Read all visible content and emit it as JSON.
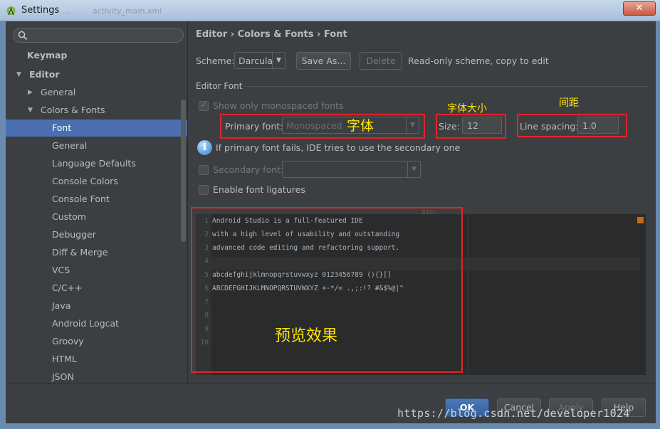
{
  "window": {
    "title": "Settings",
    "ghost_tab_1": "...",
    "ghost_tab_2": "activity_main.xml"
  },
  "sidebar": {
    "search_placeholder": "",
    "items": [
      {
        "label": "Keymap"
      },
      {
        "label": "Editor"
      },
      {
        "label": "General"
      },
      {
        "label": "Colors & Fonts"
      },
      {
        "label": "Font"
      },
      {
        "label": "General"
      },
      {
        "label": "Language Defaults"
      },
      {
        "label": "Console Colors"
      },
      {
        "label": "Console Font"
      },
      {
        "label": "Custom"
      },
      {
        "label": "Debugger"
      },
      {
        "label": "Diff & Merge"
      },
      {
        "label": "VCS"
      },
      {
        "label": "C/C++"
      },
      {
        "label": "Java"
      },
      {
        "label": "Android Logcat"
      },
      {
        "label": "Groovy"
      },
      {
        "label": "HTML"
      },
      {
        "label": "JSON"
      }
    ]
  },
  "breadcrumb": {
    "part1": "Editor",
    "part2": "Colors & Fonts",
    "part3": "Font",
    "sep": "›"
  },
  "scheme": {
    "label": "Scheme:",
    "value": "Darcula",
    "save_as": "Save As...",
    "delete": "Delete",
    "note": "Read-only scheme, copy to edit"
  },
  "editor_font": {
    "section_title": "Editor Font",
    "show_mono_label": "Show only monospaced fonts",
    "primary_label": "Primary font:",
    "primary_value": "Monospaced",
    "size_label": "Size:",
    "size_value": "12",
    "spacing_label": "Line spacing:",
    "spacing_value": "1.0",
    "fallback_info": "If primary font fails, IDE tries to use the secondary one",
    "secondary_label": "Secondary font:",
    "secondary_value": "",
    "ligatures_label": "Enable font ligatures"
  },
  "annotations": {
    "font": "字体",
    "size": "字体大小",
    "spacing": "间距",
    "preview": "预览效果"
  },
  "preview": {
    "lines": [
      {
        "n": "1",
        "text": "Android Studio is a full-featured IDE"
      },
      {
        "n": "2",
        "text": "with a high level of usability and outstanding"
      },
      {
        "n": "3",
        "text": "advanced code editing and refactoring support."
      },
      {
        "n": "4",
        "text": ""
      },
      {
        "n": "5",
        "text": "abcdefghijklmnopqrstuvwxyz 0123456789 (){}[]"
      },
      {
        "n": "6",
        "text": "ABCDEFGHIJKLMNOPQRSTUVWXYZ +-*/= .,;:!? #&$%@|^"
      },
      {
        "n": "7",
        "text": ""
      },
      {
        "n": "8",
        "text": ""
      },
      {
        "n": "9",
        "text": ""
      },
      {
        "n": "10",
        "text": ""
      }
    ]
  },
  "buttons": {
    "ok": "OK",
    "cancel": "Cancel",
    "apply": "Apply",
    "help": "Help"
  },
  "watermark": "https://blog.csdn.net/developer1024",
  "colors": {
    "background": "#3c3f41",
    "selection": "#4b6eaf",
    "annotation_box": "#e0252b",
    "annotation_text": "#ffe600"
  }
}
